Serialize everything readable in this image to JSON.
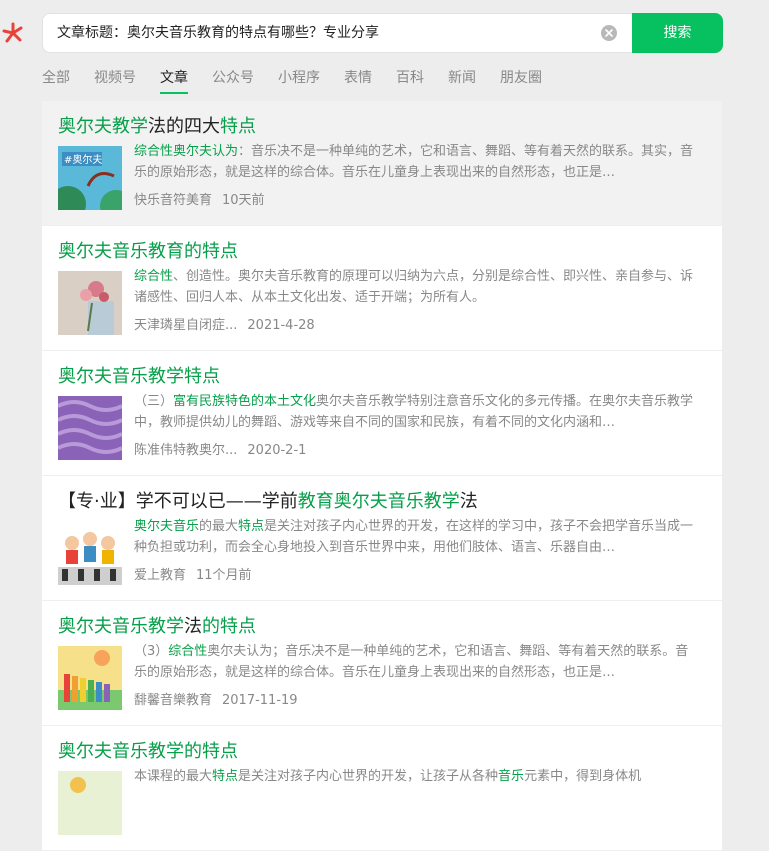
{
  "search": {
    "value": "文章标题：奥尔夫音乐教育的特点有哪些？专业分享",
    "button_label": "搜索"
  },
  "tabs": [
    "全部",
    "视频号",
    "文章",
    "公众号",
    "小程序",
    "表情",
    "百科",
    "新闻",
    "朋友圈"
  ],
  "active_tab": "文章",
  "colors": {
    "accent": "#07c160",
    "link": "#07a04a",
    "logo": "#e8433a"
  },
  "results": [
    {
      "title": [
        {
          "t": "奥尔夫教学",
          "k": 0
        },
        {
          "t": "法的四大",
          "k": 1
        },
        {
          "t": "特点",
          "k": 0
        }
      ],
      "snippet": [
        {
          "t": "综合性奥尔夫认为",
          "h": 1
        },
        {
          "t": "：音乐决不是一种单纯的艺术，它和语言、舞蹈、等有着天然的联系。其实，音乐的原始形态，就是这样的综合体。音乐在儿童身上表现出来的自然形态，也正是…",
          "h": 0
        }
      ],
      "source": "快乐音符美育",
      "date": "10天前",
      "highlight": true
    },
    {
      "title": [
        {
          "t": "奥尔夫音乐教育的特点",
          "k": 0
        }
      ],
      "snippet": [
        {
          "t": "综合性",
          "h": 1
        },
        {
          "t": "、创造性。奥尔夫音乐教育的原理可以归纳为六点，分别是综合性、即兴性、亲自参与、诉诸感性、回归人本、从本土文化出发、适于开端；为所有人。",
          "h": 0
        }
      ],
      "source": "天津璘星自闭症...",
      "date": "2021-4-28",
      "highlight": false
    },
    {
      "title": [
        {
          "t": "奥尔夫音乐教学特点",
          "k": 0
        }
      ],
      "snippet": [
        {
          "t": "（三）",
          "h": 0
        },
        {
          "t": "富有民族特色的本土文化",
          "h": 1
        },
        {
          "t": "奥尔夫音乐教学特别注意音乐文化的多元传播。在奥尔夫音乐教学中，教师提供幼儿的舞蹈、游戏等来自不同的国家和民族，有着不同的文化内涵和…",
          "h": 0
        }
      ],
      "source": "陈准伟特教奥尔...",
      "date": "2020-2-1",
      "highlight": false
    },
    {
      "title": [
        {
          "t": "【专·业】学不可以已——学前",
          "k": 1
        },
        {
          "t": "教育奥尔夫音乐教学",
          "k": 0
        },
        {
          "t": "法",
          "k": 1
        }
      ],
      "snippet": [
        {
          "t": "奥尔夫音乐",
          "h": 1
        },
        {
          "t": "的最大",
          "h": 0
        },
        {
          "t": "特点",
          "h": 1
        },
        {
          "t": "是关注对孩子内心世界的开发，在这样的学习中，孩子不会把学音乐当成一种负担或功利，而会全心身地投入到音乐世界中来，用他们肢体、语言、乐器自由…",
          "h": 0
        }
      ],
      "source": "爱上教育",
      "date": "11个月前",
      "highlight": false
    },
    {
      "title": [
        {
          "t": "奥尔夫音乐教学",
          "k": 0
        },
        {
          "t": "法",
          "k": 1
        },
        {
          "t": "的特点",
          "k": 0
        }
      ],
      "snippet": [
        {
          "t": "（3）",
          "h": 0
        },
        {
          "t": "综合性",
          "h": 1
        },
        {
          "t": "奥尔夫认为；音乐决不是一种单纯的艺术，它和语言、舞蹈、等有着天然的联系。音乐的原始形态，就是这样的综合体。音乐在儿童身上表现出来的自然形态，也正是…",
          "h": 0
        }
      ],
      "source": "馡馨音樂教育",
      "date": "2017-11-19",
      "highlight": false
    },
    {
      "title": [
        {
          "t": "奥尔夫音乐教学的特点",
          "k": 0
        }
      ],
      "snippet": [
        {
          "t": "本课程的最大",
          "h": 0
        },
        {
          "t": "特点",
          "h": 1
        },
        {
          "t": "是关注对孩子内心世界的开发，让孩子从各种",
          "h": 0
        },
        {
          "t": "音乐",
          "h": 1
        },
        {
          "t": "元素中，得到身体机",
          "h": 0
        }
      ],
      "source": "",
      "date": "",
      "highlight": false
    }
  ]
}
